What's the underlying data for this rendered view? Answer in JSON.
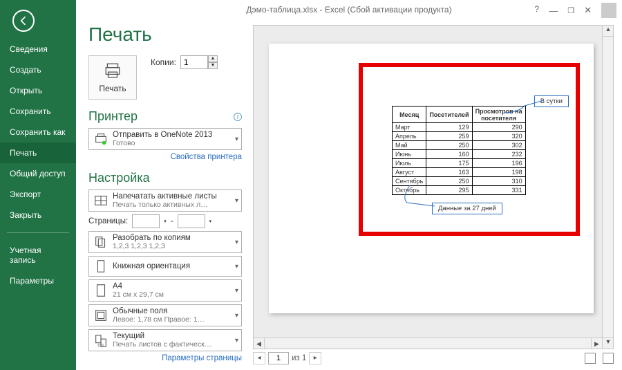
{
  "window": {
    "title": "Дэмо-таблица.xlsx - Excel (Сбой активации продукта)"
  },
  "sidebar": {
    "items": [
      "Сведения",
      "Создать",
      "Открыть",
      "Сохранить",
      "Сохранить как",
      "Печать",
      "Общий доступ",
      "Экспорт",
      "Закрыть"
    ],
    "active": 5,
    "footer": [
      "Учетная запись",
      "Параметры"
    ]
  },
  "heading": "Печать",
  "print_button": "Печать",
  "copies": {
    "label": "Копии:",
    "value": "1"
  },
  "printer": {
    "heading": "Принтер",
    "name": "Отправить в OneNote 2013",
    "status": "Готово",
    "props_link": "Свойства принтера"
  },
  "settings": {
    "heading": "Настройка",
    "active_sheets": {
      "line1": "Напечатать активные листы",
      "line2": "Печать только активных л…"
    },
    "pages": {
      "label": "Страницы:",
      "from": "",
      "to": "",
      "sep": "-"
    },
    "collate": {
      "line1": "Разобрать по копиям",
      "line2": "1,2,3   1,2,3   1,2,3"
    },
    "orientation": {
      "line1": "Книжная ориентация"
    },
    "paper": {
      "line1": "A4",
      "line2": "21 см x 29,7 см"
    },
    "margins": {
      "line1": "Обычные поля",
      "line2": "Левое: 1,78 см   Правое: 1…"
    },
    "scaling": {
      "line1": "Текущий",
      "line2": "Печать листов с фактическ…"
    },
    "page_setup_link": "Параметры страницы"
  },
  "preview": {
    "tag_daily": "В сутки",
    "tag_27": "Данные за 27 дней",
    "page_input": "1",
    "page_of": "из 1"
  },
  "chart_data": {
    "type": "table",
    "title": "",
    "columns": [
      "Месяц",
      "Посетителей",
      "Просмотров на посетителя"
    ],
    "rows": [
      [
        "Март",
        "129",
        "290"
      ],
      [
        "Апрель",
        "259",
        "320"
      ],
      [
        "Май",
        "250",
        "302"
      ],
      [
        "Июнь",
        "160",
        "232"
      ],
      [
        "Июль",
        "175",
        "196"
      ],
      [
        "Август",
        "163",
        "198"
      ],
      [
        "Сентябрь",
        "250",
        "310"
      ],
      [
        "Октябрь",
        "295",
        "331"
      ]
    ]
  }
}
